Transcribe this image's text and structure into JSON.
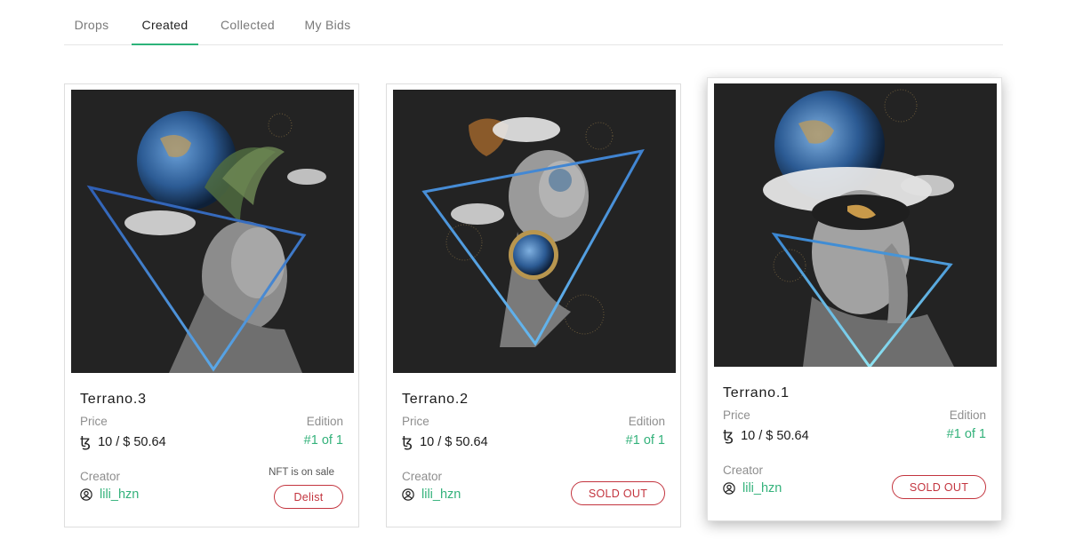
{
  "tabs": [
    {
      "label": "Drops"
    },
    {
      "label": "Created",
      "active": true
    },
    {
      "label": "Collected"
    },
    {
      "label": "My Bids"
    }
  ],
  "labels": {
    "price": "Price",
    "edition": "Edition",
    "creator": "Creator"
  },
  "currency_icon": "tezos-icon",
  "accent_color": "#2db37a",
  "danger_color": "#c3343e",
  "cards": [
    {
      "title": "Terrano.3",
      "price": "10 / $ 50.64",
      "edition": "#1 of 1",
      "creator": "lili_hzn",
      "status_note": "NFT is on sale",
      "action": "Delist"
    },
    {
      "title": "Terrano.2",
      "price": "10 / $ 50.64",
      "edition": "#1 of 1",
      "creator": "lili_hzn",
      "action": "SOLD OUT"
    },
    {
      "title": "Terrano.1",
      "price": "10 / $ 50.64",
      "edition": "#1 of 1",
      "creator": "lili_hzn",
      "action": "SOLD OUT"
    }
  ]
}
